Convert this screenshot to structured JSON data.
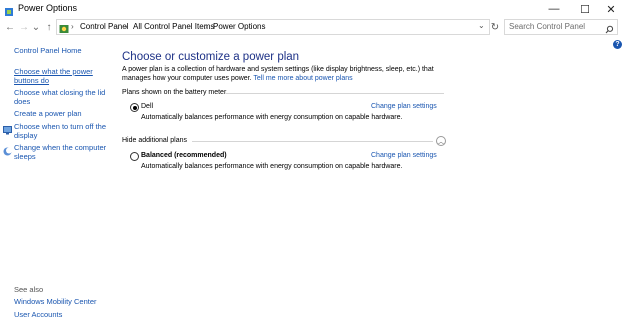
{
  "window": {
    "title": "Power Options"
  },
  "titlebar": {
    "minimize": "—",
    "maximize": "☐",
    "close": "✕"
  },
  "nav": {
    "back": "←",
    "forward": "→",
    "recent": "⌄",
    "up": "↑",
    "refresh": "↻"
  },
  "breadcrumb": [
    "Control Panel",
    "All Control Panel Items",
    "Power Options"
  ],
  "breadcrumb_sep": "›",
  "search": {
    "placeholder": "Search Control Panel"
  },
  "sidebar": {
    "home": "Control Panel Home",
    "items": [
      {
        "label": "Choose what the power buttons do",
        "line1": "Choose what the power",
        "line2": "buttons do"
      },
      {
        "label": "Choose what closing the lid does",
        "line1": "Choose what closing the lid",
        "line2": "does"
      },
      {
        "label": "Create a power plan",
        "line1": "Create a power plan"
      },
      {
        "label": "Choose when to turn off the display",
        "line1": "Choose when to turn off the",
        "line2": "display"
      },
      {
        "label": "Change when the computer sleeps",
        "line1": "Change when the computer",
        "line2": "sleeps"
      }
    ],
    "see_also_title": "See also",
    "see_also": [
      "Windows Mobility Center",
      "User Accounts"
    ]
  },
  "main": {
    "heading": "Choose or customize a power plan",
    "description": "A power plan is a collection of hardware and system settings (like display brightness, sleep, etc.) that manages how your computer uses power.",
    "description_link": "Tell me more about power plans",
    "plans_label": "Plans shown on the battery meter",
    "hide_label": "Hide additional plans",
    "plans": [
      {
        "name": "Dell",
        "selected": true,
        "description": "Automatically balances performance with energy consumption on capable hardware.",
        "change": "Change plan settings"
      },
      {
        "name": "Balanced (recommended)",
        "selected": false,
        "description": "Automatically balances performance with energy consumption on capable hardware.",
        "change": "Change plan settings"
      }
    ]
  },
  "help": "?",
  "colors": {
    "link": "#1a56b0",
    "heading": "#1e3287"
  }
}
